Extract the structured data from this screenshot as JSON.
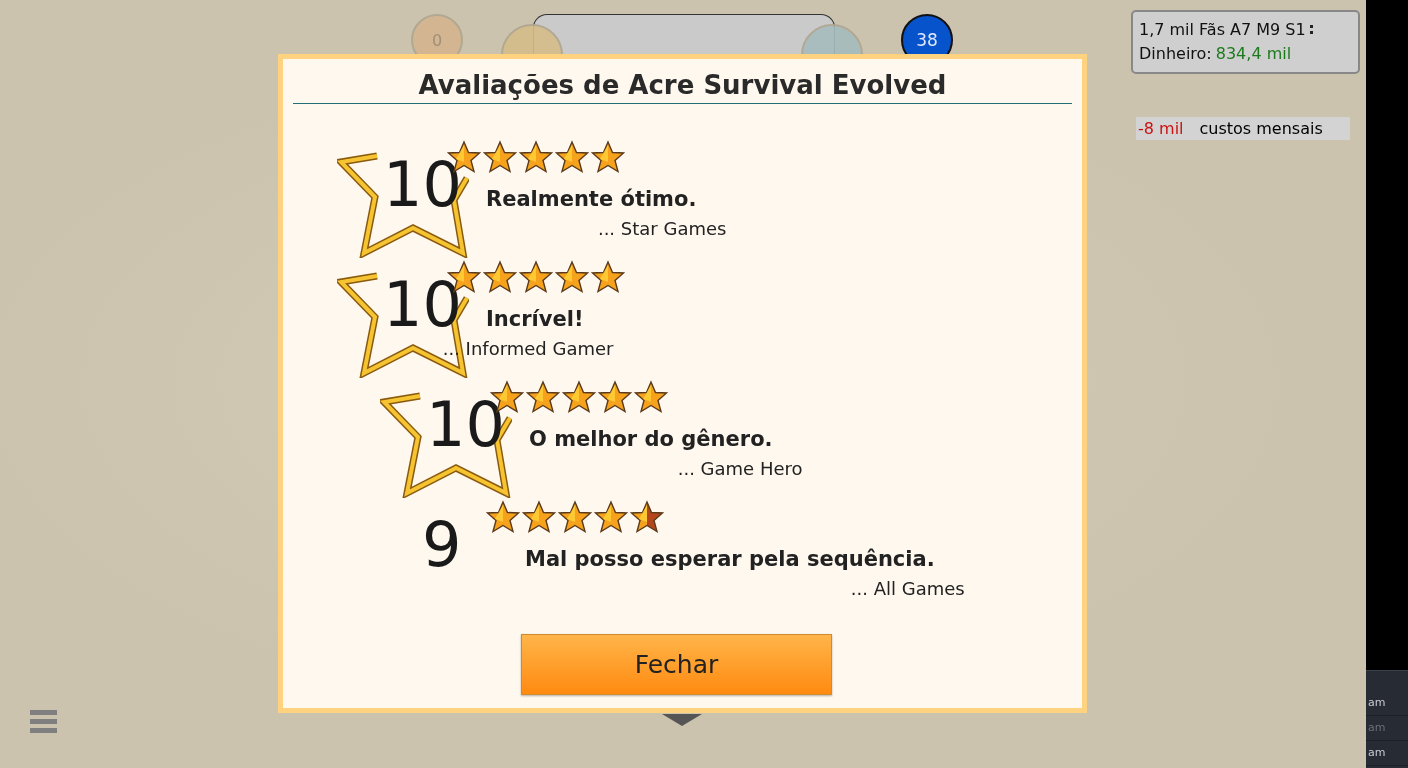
{
  "hud": {
    "circles": [
      {
        "label": "0",
        "color": "#d4b48f"
      },
      {
        "color": "#d6bd8a"
      },
      {
        "color": "#a6bcbe"
      },
      {
        "label": "38",
        "color": "#0653cc"
      }
    ]
  },
  "stats": {
    "line_1": "1,7 mil Fãs A7 M9 S1",
    "money_label": "Dinheiro:",
    "money_value": "834,4 mil"
  },
  "monthly": {
    "amount": "-8 mil",
    "label": "custos mensais"
  },
  "side_panel": {
    "items": [
      {
        "text": "am",
        "disabled": false
      },
      {
        "text": "am",
        "disabled": true
      },
      {
        "text": "am",
        "disabled": false
      }
    ]
  },
  "dialog": {
    "title": "Avaliações de Acre Survival Evolved",
    "reviews": [
      {
        "score": "10",
        "stars": 5,
        "award": true,
        "quote": "Realmente ótimo.",
        "source": "... Star Games"
      },
      {
        "score": "10",
        "stars": 5,
        "award": true,
        "quote": "Incrível!",
        "source": "... Informed Gamer"
      },
      {
        "score": "10",
        "stars": 5,
        "award": true,
        "quote": "O melhor do gênero.",
        "source": "... Game Hero"
      },
      {
        "score": "9",
        "stars": 4.5,
        "award": false,
        "quote": "Mal posso esperar pela sequência.",
        "source": "... All Games"
      }
    ],
    "close_button": "Fechar"
  }
}
